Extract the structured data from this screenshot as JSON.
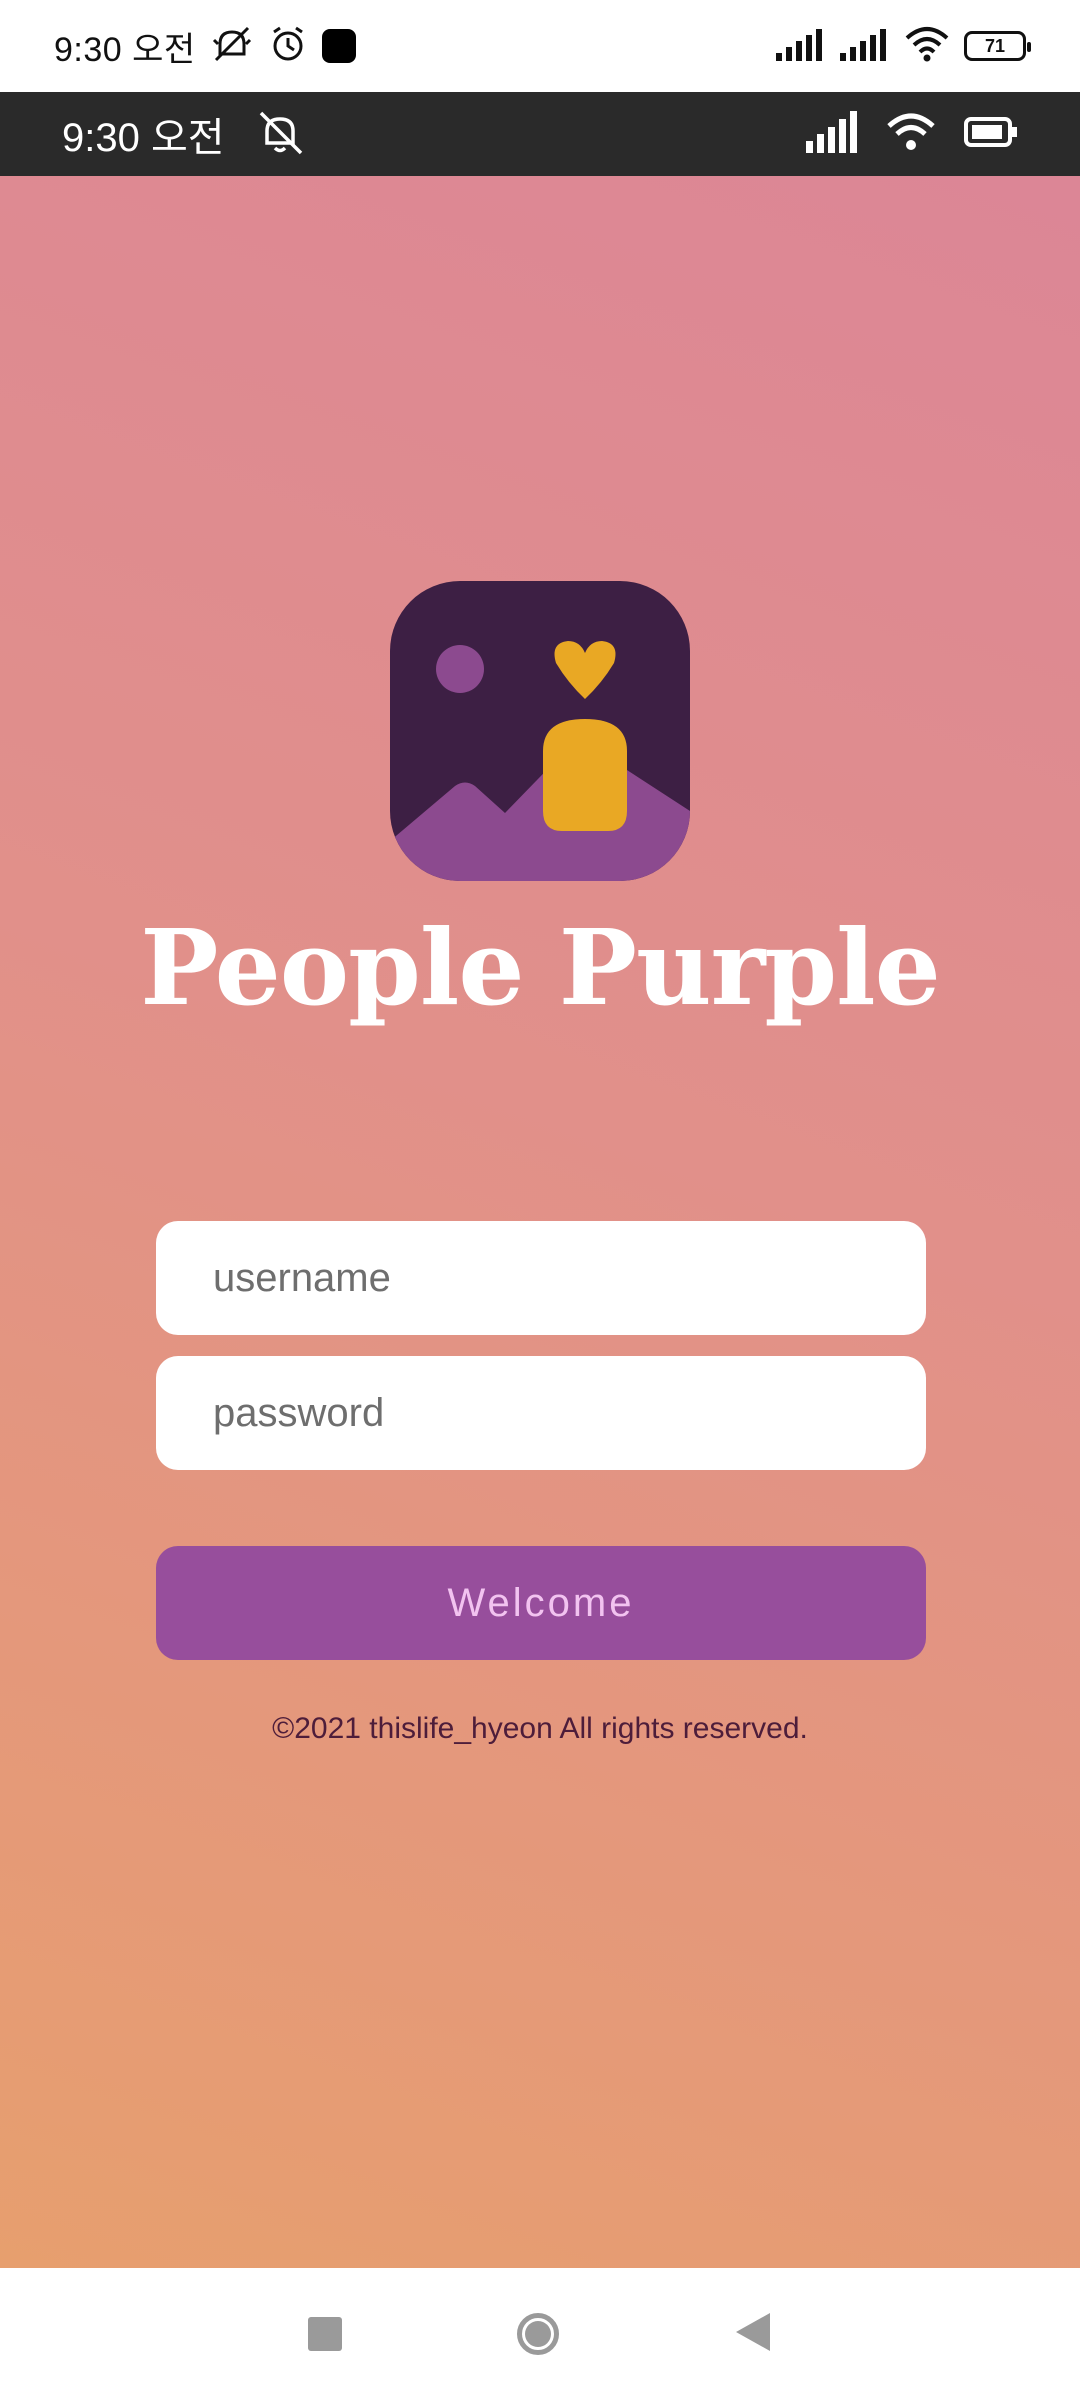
{
  "system_status": {
    "time": "9:30 오전",
    "battery": "71"
  },
  "app_status": {
    "time": "9:30 오전"
  },
  "branding": {
    "app_name": "People Purple",
    "logo_colors": {
      "background": "#3d1f44",
      "hill": "#8c4a8f",
      "accent": "#e9a824",
      "moon": "#8c4a8f"
    }
  },
  "login": {
    "username_placeholder": "username",
    "password_placeholder": "password",
    "submit_label": "Welcome"
  },
  "footer": {
    "copyright": "©2021 thislife_hyeon All rights reserved."
  },
  "nav": {
    "icons": [
      "recents-icon",
      "home-icon",
      "back-icon"
    ]
  },
  "colors": {
    "gradient_top": "#dc8696",
    "gradient_bottom": "#e79f6e",
    "button": "#974e9c",
    "button_text": "#f2c3f0",
    "footer_text": "#4d1d3a"
  }
}
